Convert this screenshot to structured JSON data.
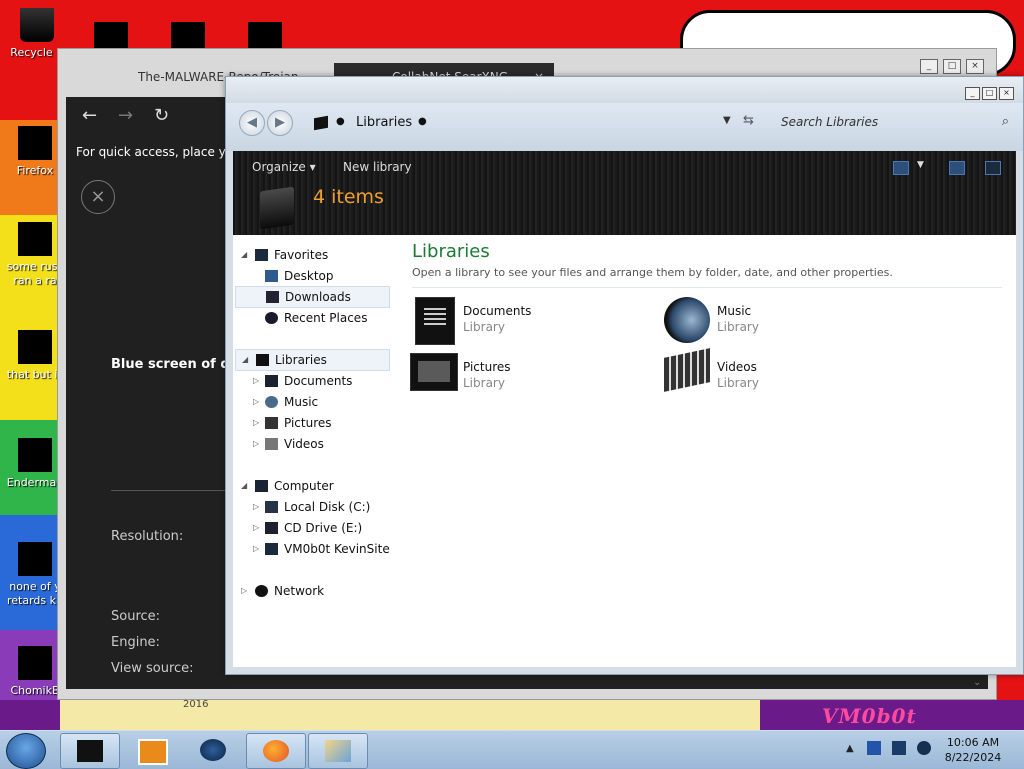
{
  "desktop": {
    "icons": [
      {
        "label": "Recycle B",
        "label2": ""
      },
      {
        "label": "Firefox",
        "label2": ""
      },
      {
        "label": "some russ",
        "label2": "ran a ra"
      },
      {
        "label": "that but is",
        "label2": ""
      },
      {
        "label": "Enderman",
        "label2": ""
      },
      {
        "label": "none of y",
        "label2": "retards kn"
      },
      {
        "label": "ChomikB",
        "label2": ""
      }
    ],
    "wallpaper_text": "VM0b0t",
    "year_text": "2016"
  },
  "browser": {
    "tabs": [
      {
        "label": "The-MALWARE-Repo/Trojan",
        "close": "×"
      },
      {
        "label": "CollabNet SearXNG",
        "close": "×"
      }
    ],
    "quick_access": "For quick access, place your",
    "close_symbol": "×",
    "heading": "Blue screen of dea",
    "labels": {
      "resolution": "Resolution:",
      "source": "Source:",
      "engine": "Engine:",
      "view_source": "View source:"
    },
    "nav": {
      "back": "←",
      "forward": "→",
      "reload": "↻"
    },
    "scroll_arrow": "⌄"
  },
  "explorer": {
    "breadcrumb": "Libraries",
    "search_placeholder": "Search Libraries",
    "toolbar": {
      "organize": "Organize ▾",
      "new_library": "New library"
    },
    "item_count": "4 items",
    "nav": {
      "favorites": "Favorites",
      "favorites_items": [
        "Desktop",
        "Downloads",
        "Recent Places"
      ],
      "libraries": "Libraries",
      "libraries_items": [
        "Documents",
        "Music",
        "Pictures",
        "Videos"
      ],
      "computer": "Computer",
      "computer_items": [
        "Local Disk (C:)",
        "CD Drive (E:)",
        "VM0b0t KevinSite"
      ],
      "network": "Network"
    },
    "content": {
      "title": "Libraries",
      "subtitle": "Open a library to see your files and arrange them by folder, date, and other properties.",
      "items": [
        {
          "name": "Documents",
          "type": "Library"
        },
        {
          "name": "Music",
          "type": "Library"
        },
        {
          "name": "Pictures",
          "type": "Library"
        },
        {
          "name": "Videos",
          "type": "Library"
        }
      ]
    }
  },
  "taskbar": {
    "time": "10:06 AM",
    "date": "8/22/2024",
    "tray_arrow": "▲"
  }
}
